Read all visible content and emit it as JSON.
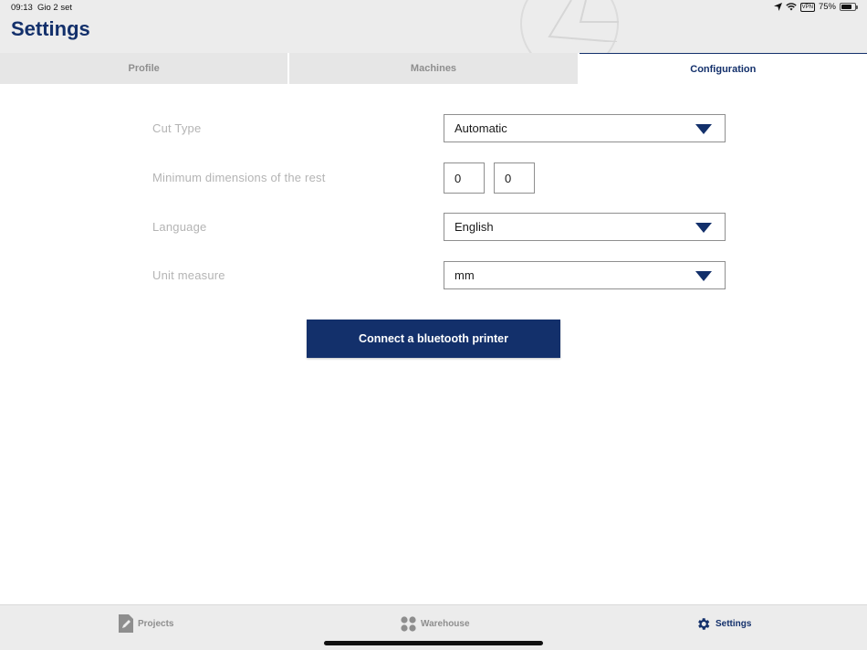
{
  "status_bar": {
    "time": "09:13",
    "date": "Gio 2 set",
    "vpn": "VPN",
    "battery": "75%",
    "battery_level": 0.75
  },
  "header": {
    "title": "Settings"
  },
  "tabs": [
    {
      "label": "Profile",
      "active": false
    },
    {
      "label": "Machines",
      "active": false
    },
    {
      "label": "Configuration",
      "active": true
    }
  ],
  "form": {
    "cut_type": {
      "label": "Cut Type",
      "value": "Automatic"
    },
    "min_dimensions": {
      "label": "Minimum dimensions of the rest",
      "value1": "0",
      "value2": "0"
    },
    "language": {
      "label": "Language",
      "value": "English"
    },
    "unit_measure": {
      "label": "Unit measure",
      "value": "mm"
    }
  },
  "bluetooth_button": {
    "label": "Connect a bluetooth printer"
  },
  "bottom_nav": [
    {
      "label": "Projects",
      "icon": "document-edit-icon",
      "active": false
    },
    {
      "label": "Warehouse",
      "icon": "grid-dots-icon",
      "active": false
    },
    {
      "label": "Settings",
      "icon": "gear-icon",
      "active": true
    }
  ],
  "colors": {
    "brand": "#13306b",
    "header_bg": "#ececec",
    "inactive_tab_bg": "#e6e6e6",
    "muted_text": "#8e8e8e",
    "label_text": "#b4b4b4"
  }
}
